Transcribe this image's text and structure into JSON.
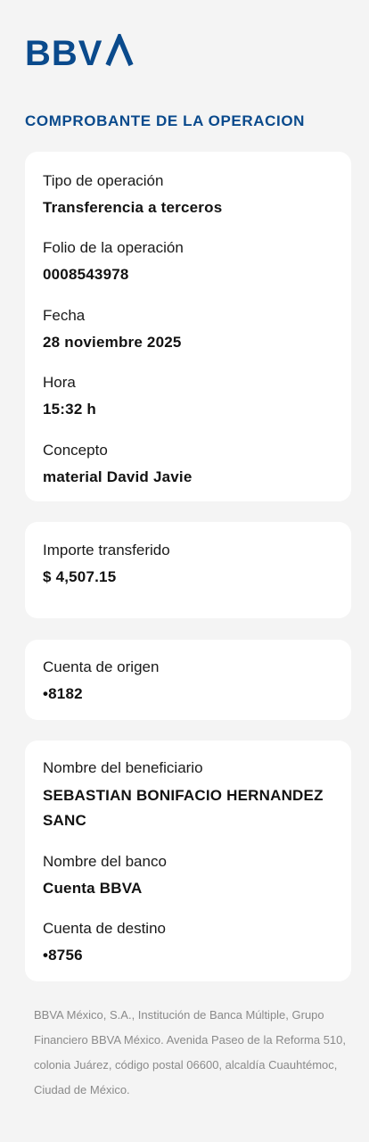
{
  "brand": {
    "logo_text": "BBVA",
    "color": "#0a4a8c"
  },
  "title": "COMPROBANTE DE LA OPERACION",
  "operation": {
    "type_label": "Tipo de operación",
    "type_value": "Transferencia a terceros",
    "folio_label": "Folio de la operación",
    "folio_value": "0008543978",
    "date_label": "Fecha",
    "date_value": "28 noviembre 2025",
    "time_label": "Hora",
    "time_value": "15:32 h",
    "concept_label": "Concepto",
    "concept_value": "material David Javie"
  },
  "amount": {
    "label": "Importe transferido",
    "value": "$ 4,507.15"
  },
  "origin": {
    "label": "Cuenta de origen",
    "value": "•8182"
  },
  "beneficiary": {
    "name_label": "Nombre del beneficiario",
    "name_value": "SEBASTIAN BONIFACIO HERNANDEZ SANC",
    "bank_label": "Nombre del banco",
    "bank_value": "Cuenta BBVA",
    "account_label": "Cuenta de destino",
    "account_value": "•8756"
  },
  "footer": "BBVA México, S.A., Institución de Banca Múltiple, Grupo Financiero BBVA México. Avenida Paseo de la Reforma 510, colonia Juárez, código postal 06600, alcaldía Cuauhtémoc, Ciudad de México."
}
